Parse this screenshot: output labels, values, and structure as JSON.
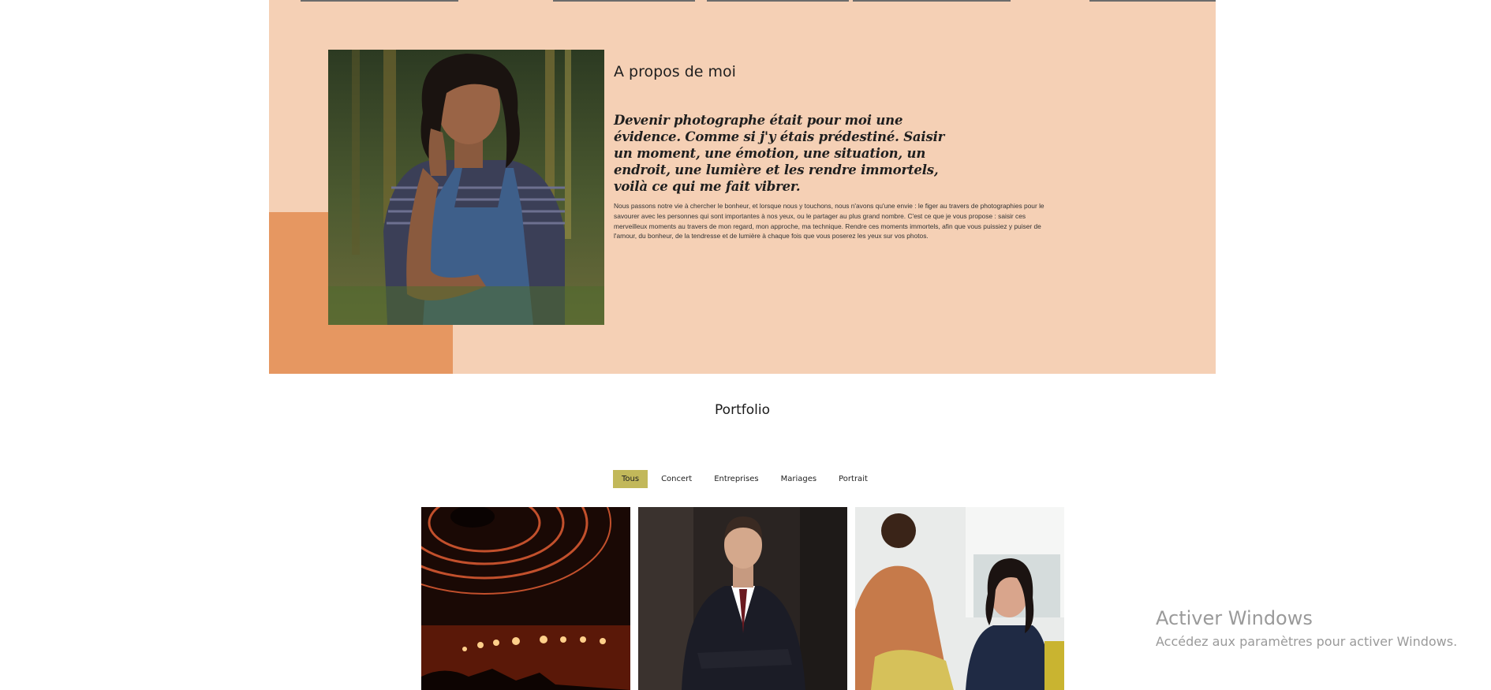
{
  "about": {
    "title": "A propos de moi",
    "quote": "Devenir photographe était pour moi une évidence. Comme si j'y étais prédestiné. Saisir un moment, une émotion, une situation, un endroit, une lumière et les rendre immortels, voilà ce qui me fait vibrer.",
    "body": "Nous passons notre vie à chercher le bonheur, et lorsque nous y touchons, nous n'avons qu'une envie : le figer au travers de photographies pour le savourer avec les personnes qui sont importantes à nos yeux, ou le partager au plus grand nombre. C'est ce que je vous propose : saisir ces merveilleux moments au travers de mon regard, mon approche, ma technique. Rendre ces moments immortels, afin que vous puissiez y puiser de l'amour, du bonheur, de la tendresse et de lumière à chaque fois que vous poserez les yeux sur vos photos."
  },
  "portfolio": {
    "title": "Portfolio",
    "filters": [
      "Tous",
      "Concert",
      "Entreprises",
      "Mariages",
      "Portrait"
    ],
    "active_filter": "Tous"
  },
  "watermark": {
    "title": "Activer Windows",
    "subtitle": "Accédez aux paramètres pour activer Windows."
  },
  "colors": {
    "about_bg": "#f5d0b5",
    "accent_orange": "#e69761",
    "active_filter": "#c2b85a"
  }
}
